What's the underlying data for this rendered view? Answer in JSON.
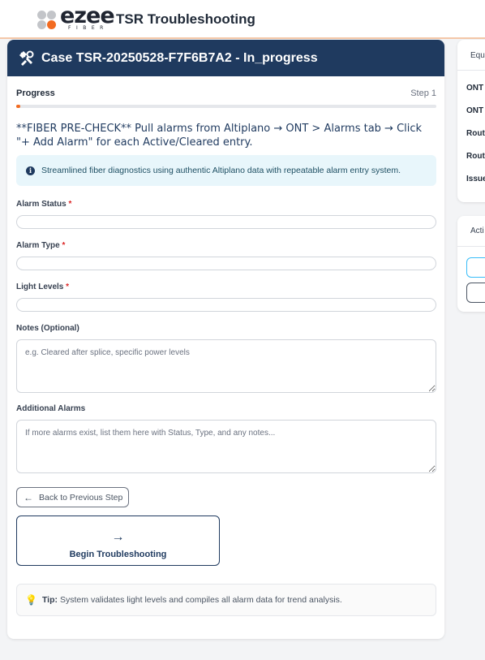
{
  "header": {
    "logo_text": "ezee",
    "logo_subtext": "FIBER",
    "app_title": "TSR Troubleshooting"
  },
  "case": {
    "title": "Case TSR-20250528-F7F6B7A2 - In_progress",
    "icon": "tools-icon"
  },
  "progress": {
    "label": "Progress",
    "step": "Step 1",
    "value": 0.01
  },
  "instruction": "**FIBER PRE-CHECK** Pull alarms from Altiplano → ONT > Alarms tab → Click \"+ Add Alarm\" for each Active/Cleared entry.",
  "info": {
    "icon": "info-icon",
    "text": "Streamlined fiber diagnostics using authentic Altiplano data with repeatable alarm entry system."
  },
  "form": {
    "alarm_status_label": "Alarm Status",
    "alarm_type_label": "Alarm Type",
    "light_levels_label": "Light Levels",
    "required_marker": "*",
    "notes_label": "Notes (Optional)",
    "notes_placeholder": "e.g. Cleared after splice, specific power levels",
    "additional_label": "Additional Alarms",
    "additional_placeholder": "If more alarms exist, list them here with Status, Type, and any notes..."
  },
  "buttons": {
    "back": "Back to Previous Step",
    "begin": "Begin Troubleshooting"
  },
  "tip": {
    "icon": "lightbulb-icon",
    "label": "Tip:",
    "text": "System validates light levels and compiles all alarm data for trend analysis."
  },
  "sidebar": {
    "equipment_header": "Equ",
    "rows": [
      "ONT",
      "ONT",
      "Rout",
      "Rout",
      "Issue"
    ],
    "actions_header": "Acti"
  },
  "colors": {
    "brand_navy": "#1f3a5f",
    "accent_orange": "#f26b21",
    "info_bg": "#e8f6fb"
  }
}
